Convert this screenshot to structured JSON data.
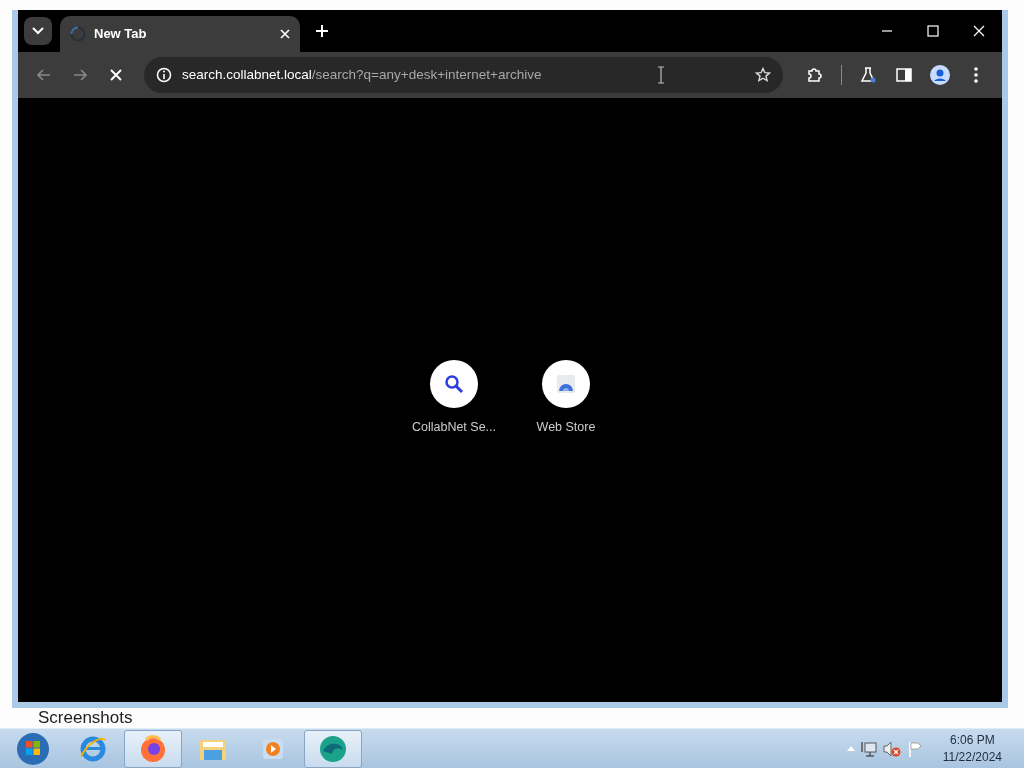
{
  "desktop": {
    "label": "Screenshots"
  },
  "browser": {
    "tabs": [
      {
        "title": "New Tab",
        "selected": true,
        "loading": true
      }
    ],
    "loading": true,
    "address": {
      "host": "search.collabnet.local",
      "path": "/search?q=any+desk+internet+archive"
    },
    "shortcuts": [
      {
        "label": "CollabNet Se...",
        "kind": "search"
      },
      {
        "label": "Web Store",
        "kind": "store"
      }
    ]
  },
  "taskbar": {
    "apps": [
      {
        "kind": "ie",
        "running": false
      },
      {
        "kind": "firefox",
        "running": true
      },
      {
        "kind": "folder",
        "running": false
      },
      {
        "kind": "media",
        "running": false
      },
      {
        "kind": "edge",
        "running": true
      }
    ],
    "clock": {
      "time": "6:06 PM",
      "date": "11/22/2024"
    }
  }
}
